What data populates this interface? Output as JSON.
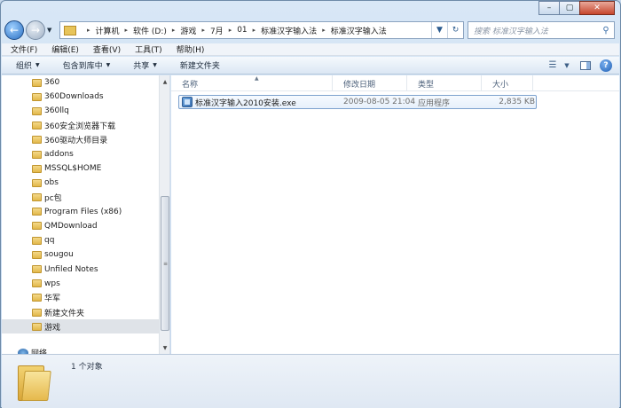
{
  "window": {
    "caption_buttons": [
      "–",
      "▢",
      "✕"
    ]
  },
  "address_bar": {
    "breadcrumbs": [
      "计算机",
      "软件 (D:)",
      "游戏",
      "7月",
      "01",
      "标准汉字输入法",
      "标准汉字输入法"
    ],
    "search_placeholder": "搜索 标准汉字输入法"
  },
  "menu": [
    "文件(F)",
    "编辑(E)",
    "查看(V)",
    "工具(T)",
    "帮助(H)"
  ],
  "command_bar": {
    "organize": "组织",
    "include_in_library": "包含到库中",
    "share": "共享",
    "new_folder": "新建文件夹"
  },
  "nav_tree": {
    "items": [
      "360",
      "360Downloads",
      "360llq",
      "360安全浏览器下载",
      "360驱动大师目录",
      "addons",
      "MSSQL$HOME",
      "obs",
      "pc包",
      "Program Files (x86)",
      "QMDownload",
      "qq",
      "sougou",
      "Unfiled Notes",
      "wps",
      "华军",
      "新建文件夹",
      "游戏"
    ],
    "selected": "游戏",
    "network_label": "网络"
  },
  "columns": {
    "name": "名称",
    "date": "修改日期",
    "type": "类型",
    "size": "大小"
  },
  "files": [
    {
      "name": "标准汉字输入2010安装.exe",
      "date": "2009-08-05 21:04",
      "type": "应用程序",
      "size": "2,835 KB"
    }
  ],
  "details": {
    "count": "1 个对象"
  },
  "icons": {
    "back": "arrow-left-icon",
    "forward": "arrow-right-icon",
    "refresh": "refresh-icon",
    "search": "search-icon",
    "help": "help-icon"
  },
  "colors": {
    "window_frame": "#c3d7ee",
    "selection": "#dfe3e8",
    "file_row_border": "#7da2ce"
  }
}
